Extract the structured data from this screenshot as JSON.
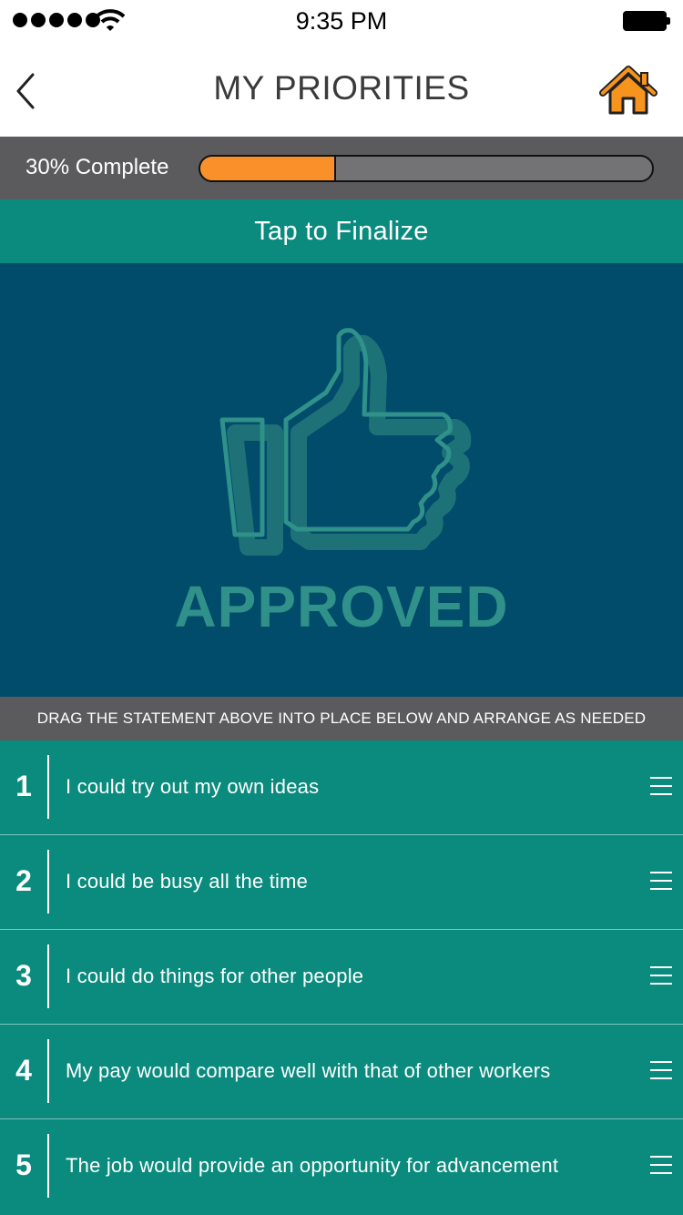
{
  "status_bar": {
    "time": "9:35 PM"
  },
  "header": {
    "title": "MY PRIORITIES"
  },
  "progress": {
    "label": "30% Complete",
    "value": 0.3,
    "fill_color": "#f9902a",
    "track_color": "#737375"
  },
  "finalize": {
    "label": "Tap to Finalize"
  },
  "card": {
    "title": "APPROVED",
    "icon": "thumbs-up-icon"
  },
  "instruction": {
    "text": "DRAG THE STATEMENT ABOVE INTO PLACE BELOW AND ARRANGE AS NEEDED"
  },
  "priorities": [
    {
      "number": "1",
      "text": "I could try out my own ideas"
    },
    {
      "number": "2",
      "text": "I could be busy all the time"
    },
    {
      "number": "3",
      "text": "I could do things for other people"
    },
    {
      "number": "4",
      "text": "My pay would compare well with that of other workers"
    },
    {
      "number": "5",
      "text": "The job would provide an opportunity for advancement"
    }
  ],
  "colors": {
    "teal": "#0b8b7e",
    "navy_panel": "#014b6b",
    "gray_bar": "#5b5b5d",
    "orange": "#f9902a"
  }
}
